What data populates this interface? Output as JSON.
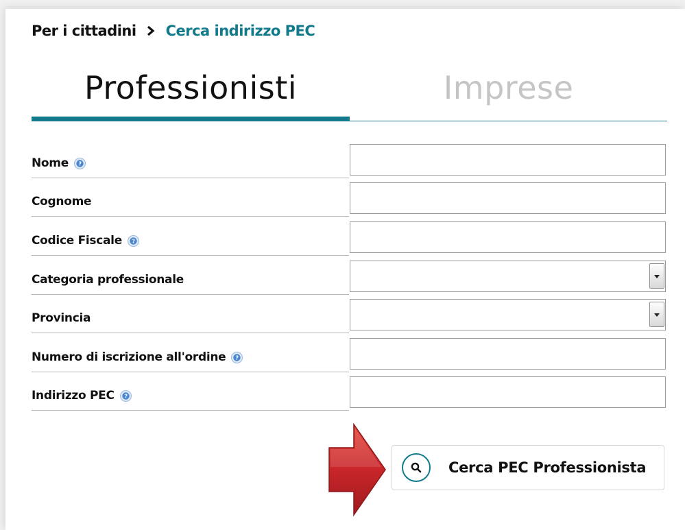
{
  "breadcrumb": {
    "root": "Per i cittadini",
    "current": "Cerca indirizzo PEC"
  },
  "tabs": [
    {
      "label": "Professionisti",
      "active": true
    },
    {
      "label": "Imprese",
      "active": false
    }
  ],
  "form": {
    "fields": [
      {
        "label": "Nome",
        "help": true,
        "type": "text",
        "value": ""
      },
      {
        "label": "Cognome",
        "help": false,
        "type": "text",
        "value": ""
      },
      {
        "label": "Codice Fiscale",
        "help": true,
        "type": "text",
        "value": ""
      },
      {
        "label": "Categoria professionale",
        "help": false,
        "type": "select",
        "value": ""
      },
      {
        "label": "Provincia",
        "help": false,
        "type": "select",
        "value": ""
      },
      {
        "label": "Numero di iscrizione all'ordine",
        "help": true,
        "type": "text",
        "value": ""
      },
      {
        "label": "Indirizzo PEC",
        "help": true,
        "type": "text",
        "value": ""
      }
    ]
  },
  "search_button": {
    "label": "Cerca PEC Professionista",
    "icon": "search-icon"
  },
  "colors": {
    "accent": "#117a8b",
    "inactive_tab": "#c5c5c5",
    "help_icon": "#4a90d9",
    "arrow": "#c8262a"
  },
  "icons": {
    "breadcrumb_separator": "chevron-right-icon",
    "help": "help-icon",
    "select": "dropdown-arrow-icon",
    "pointer": "red-arrow-icon"
  }
}
